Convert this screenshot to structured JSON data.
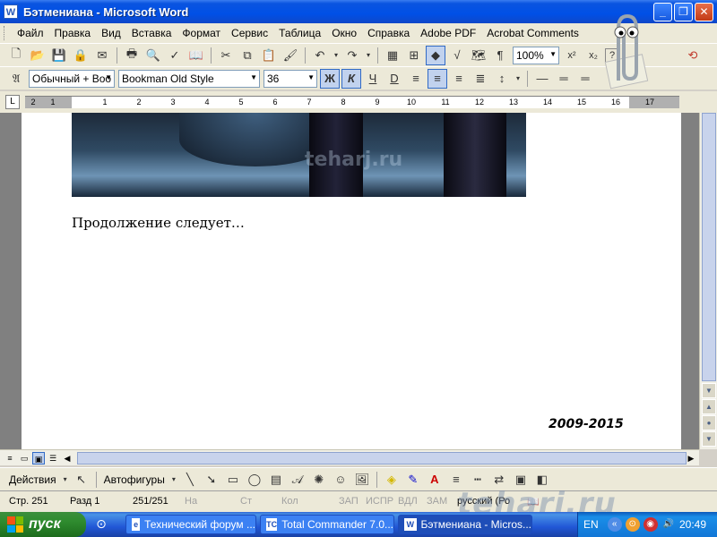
{
  "window": {
    "title": "Бэтмениана - Microsoft Word",
    "app_icon": "W",
    "buttons": [
      "minimize",
      "maximize",
      "close"
    ]
  },
  "menu": [
    "Файл",
    "Правка",
    "Вид",
    "Вставка",
    "Формат",
    "Сервис",
    "Таблица",
    "Окно",
    "Справка",
    "Adobe PDF",
    "Acrobat Comments"
  ],
  "toolbar_standard": {
    "zoom": "100%",
    "icons": [
      "new-icon",
      "open-icon",
      "save-icon",
      "permission-icon",
      "email-icon",
      "print-icon",
      "print-preview-icon",
      "spelling-icon",
      "cut-icon",
      "copy-icon",
      "paste-icon",
      "format-painter-icon",
      "undo-icon",
      "redo-icon",
      "tables-borders-icon",
      "insert-table-icon",
      "insert-excel-icon",
      "columns-icon",
      "drawing-icon",
      "document-map-icon",
      "show-hide-icon",
      "help-icon"
    ],
    "superscript": "x²",
    "subscript": "x₂"
  },
  "toolbar_formatting": {
    "style": "Обычный + Boo",
    "font": "Bookman Old Style",
    "size": "36",
    "bold": "Ж",
    "italic": "К",
    "underline": "Ч",
    "underline_d": "D"
  },
  "ruler": {
    "numbers": [
      "2",
      "1",
      "1",
      "2",
      "3",
      "4",
      "5",
      "6",
      "7",
      "8",
      "9",
      "10",
      "11",
      "12",
      "13",
      "14",
      "15",
      "16",
      "17"
    ]
  },
  "document": {
    "text": "Продолжение следует…",
    "years": "2009-2015",
    "image_watermark": "teharj.ru"
  },
  "drawing_toolbar": {
    "actions": "Действия",
    "autoshapes": "Автофигуры"
  },
  "statusbar": {
    "page": "Стр.  251",
    "section": "Разд  1",
    "pages": "251/251",
    "at": "На",
    "line": "Ст",
    "col": "Кол",
    "rec": "ЗАП",
    "trk": "ИСПР",
    "ext": "ВДЛ",
    "ovr": "ЗАМ",
    "language": "русский (Ро",
    "watermark": "teharj.ru"
  },
  "taskbar": {
    "start": "пуск",
    "tasks": [
      {
        "label": "Технический форум ...",
        "active": false
      },
      {
        "label": "Total Commander 7.0...",
        "active": false
      },
      {
        "label": "Бэтмениана - Micros...",
        "active": true
      }
    ],
    "lang": "EN",
    "clock": "20:49"
  },
  "colors": {
    "titlebar": "#0a54e0",
    "taskbar": "#2157d7",
    "start": "#2e8b2e",
    "toolbar": "#ece9d8"
  }
}
